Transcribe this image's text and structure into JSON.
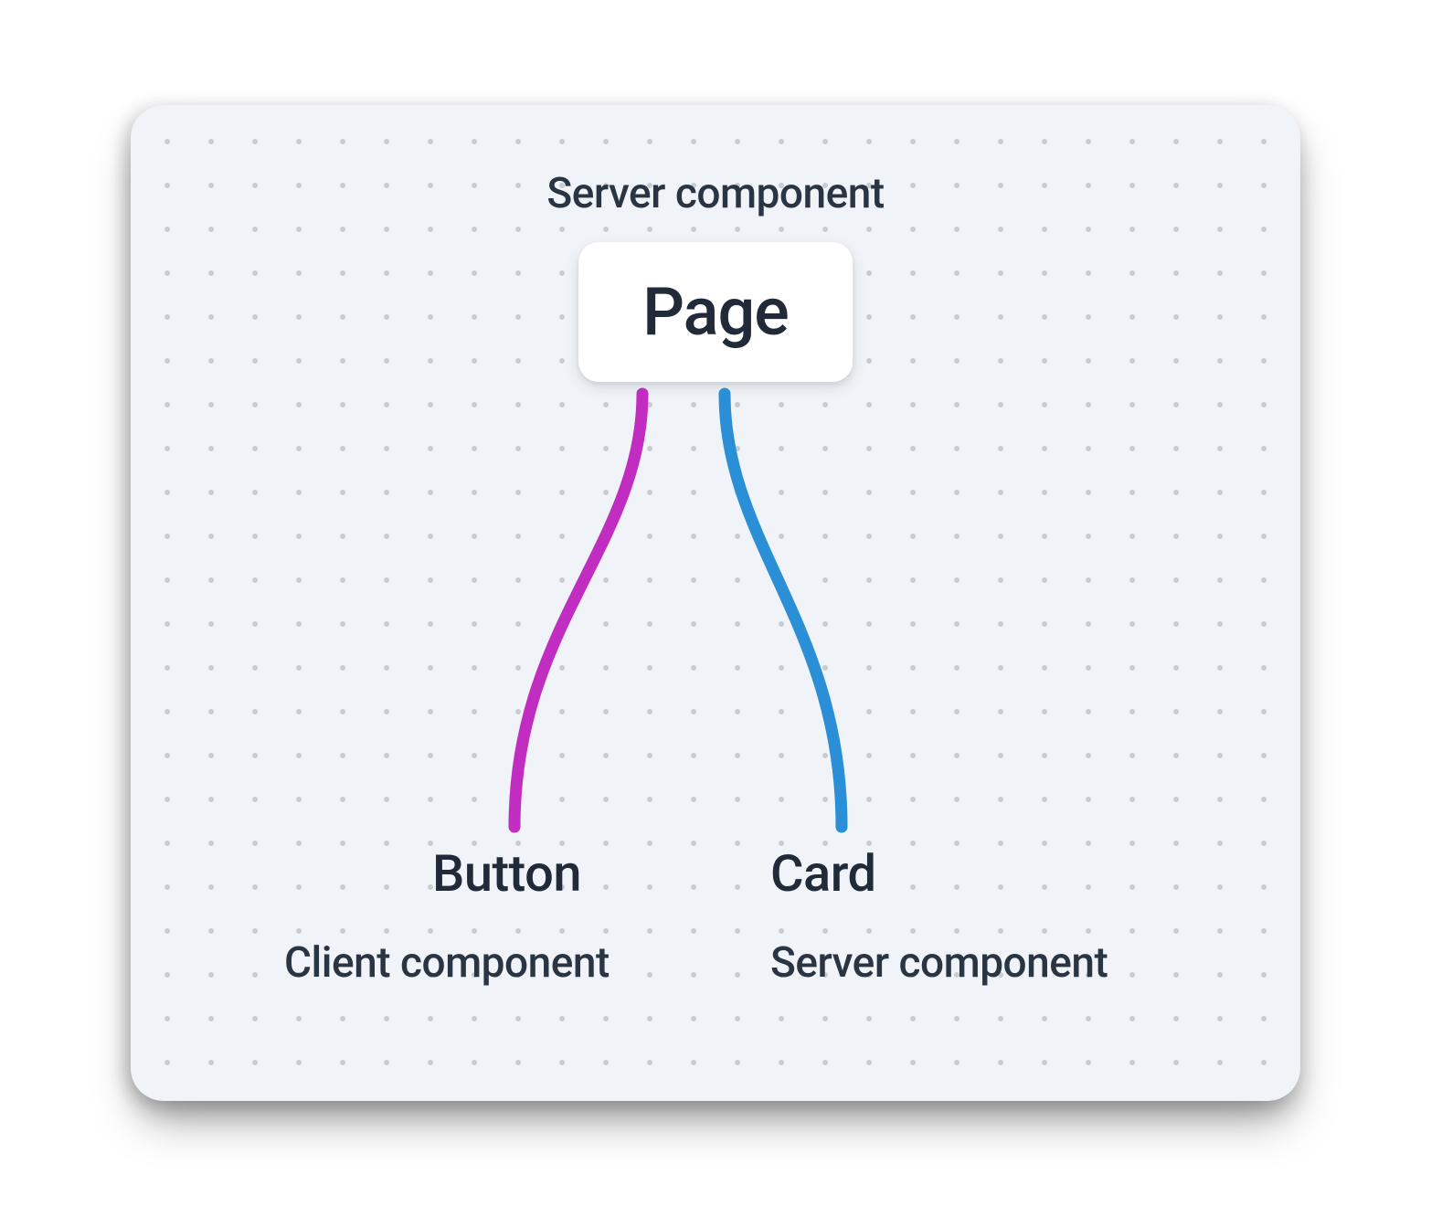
{
  "diagram": {
    "root": {
      "type_label": "Server component",
      "name": "Page"
    },
    "children": [
      {
        "name": "Button",
        "type_label": "Client component",
        "edge_color": "#c12dc1"
      },
      {
        "name": "Card",
        "type_label": "Server component",
        "edge_color": "#2a8fd6"
      }
    ]
  }
}
